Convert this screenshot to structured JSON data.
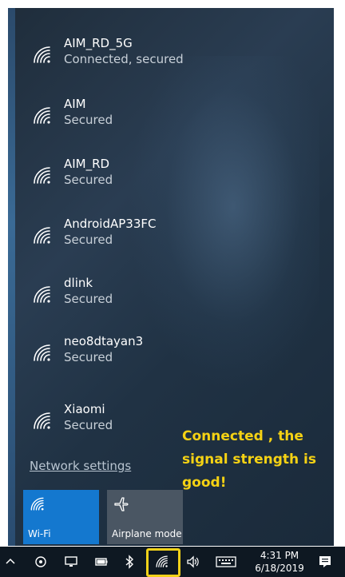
{
  "networks": [
    {
      "name": "AIM_RD_5G",
      "status": "Connected, secured"
    },
    {
      "name": "AIM",
      "status": "Secured"
    },
    {
      "name": "AIM_RD",
      "status": "Secured"
    },
    {
      "name": "AndroidAP33FC",
      "status": "Secured"
    },
    {
      "name": "dlink",
      "status": "Secured"
    },
    {
      "name": "neo8dtayan3",
      "status": "Secured"
    },
    {
      "name": "Xiaomi",
      "status": "Secured"
    }
  ],
  "network_settings_label": "Network settings",
  "annotation_text": "Connected , the signal strength is good!",
  "tiles": {
    "wifi_label": "Wi-Fi",
    "airplane_label": "Airplane mode"
  },
  "clock": {
    "time": "4:31 PM",
    "date": "6/18/2019"
  },
  "colors": {
    "accent": "#1478cf",
    "annotation": "#f5d214",
    "highlight_box": "#f2d21a",
    "taskbar": "#0e1822"
  }
}
